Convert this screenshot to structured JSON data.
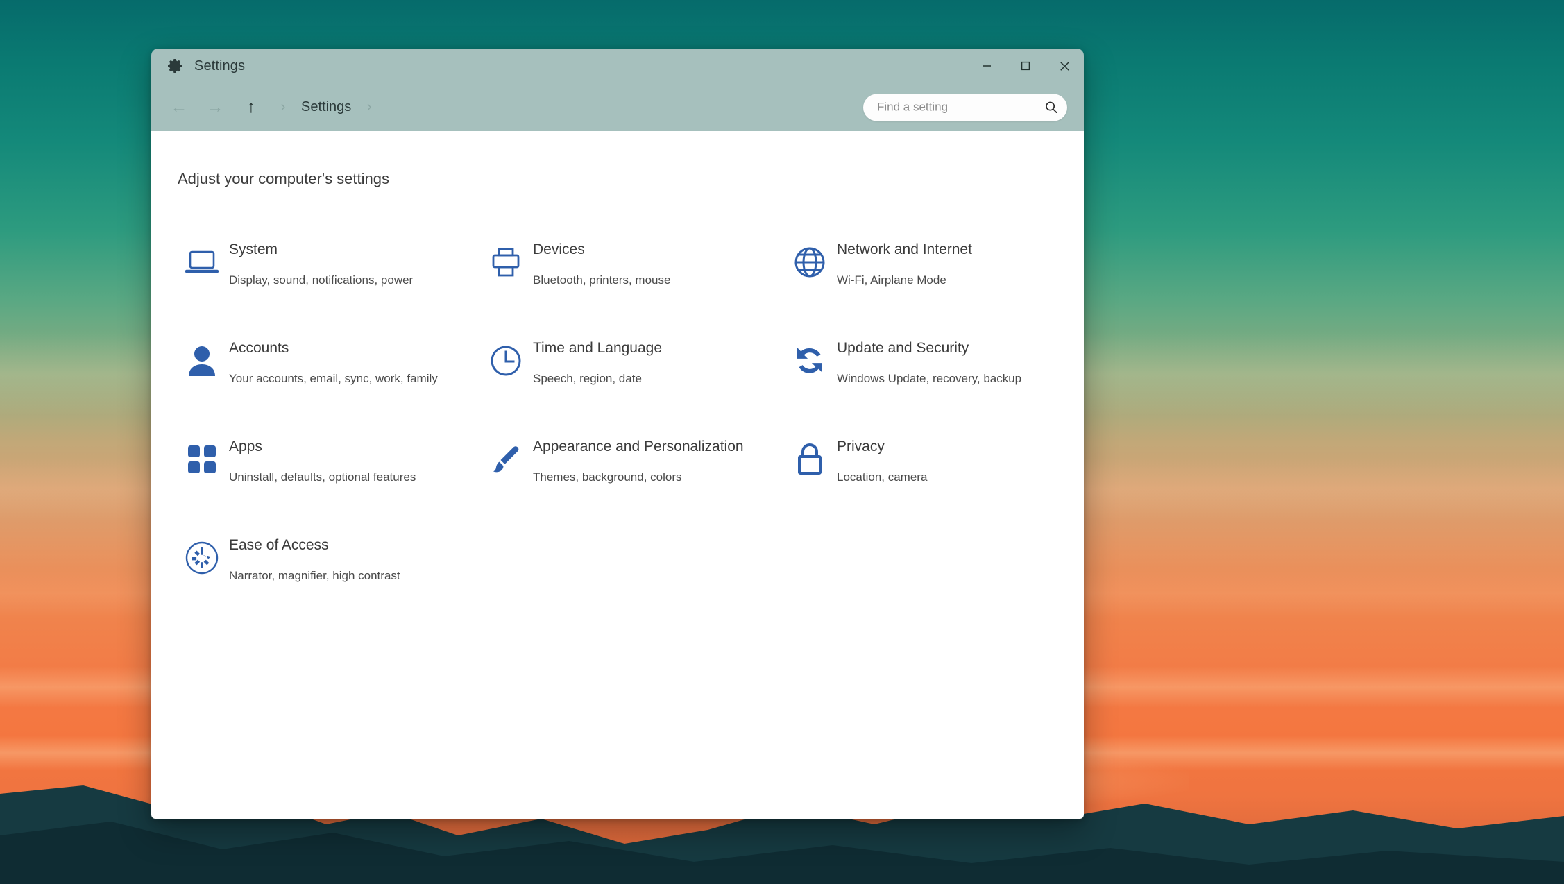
{
  "window": {
    "app_icon": "gear-icon",
    "title": "Settings",
    "controls": {
      "minimize": "─",
      "maximize": "□",
      "close": "✕"
    }
  },
  "navbar": {
    "back": "←",
    "forward": "→",
    "up": "↑",
    "separator": "›",
    "breadcrumb": "Settings",
    "trailing_separator": "›"
  },
  "search": {
    "placeholder": "Find a setting",
    "value": "",
    "icon": "search-icon"
  },
  "main": {
    "heading": "Adjust your computer's settings",
    "tiles": [
      {
        "icon": "laptop-icon",
        "title": "System",
        "subtitle": "Display, sound, notifications, power"
      },
      {
        "icon": "printer-icon",
        "title": "Devices",
        "subtitle": "Bluetooth, printers, mouse"
      },
      {
        "icon": "globe-icon",
        "title": "Network and Internet",
        "subtitle": "Wi-Fi, Airplane Mode"
      },
      {
        "icon": "person-icon",
        "title": "Accounts",
        "subtitle": "Your accounts, email, sync, work, family"
      },
      {
        "icon": "clock-icon",
        "title": "Time and Language",
        "subtitle": "Speech, region, date"
      },
      {
        "icon": "sync-icon",
        "title": "Update and Security",
        "subtitle": "Windows Update, recovery, backup"
      },
      {
        "icon": "grid-squares-icon",
        "title": "Apps",
        "subtitle": "Uninstall, defaults, optional features"
      },
      {
        "icon": "paintbrush-icon",
        "title": "Appearance and Personalization",
        "subtitle": "Themes, background, colors"
      },
      {
        "icon": "lock-icon",
        "title": "Privacy",
        "subtitle": "Location, camera"
      },
      {
        "icon": "accessibility-icon",
        "title": "Ease of Access",
        "subtitle": "Narrator, magnifier, high contrast"
      }
    ]
  },
  "colors": {
    "titlebar": "#a6c0bd",
    "accent_icon": "#2f5fab",
    "window_body": "#ffffff",
    "text_primary": "#3b3b3b"
  }
}
